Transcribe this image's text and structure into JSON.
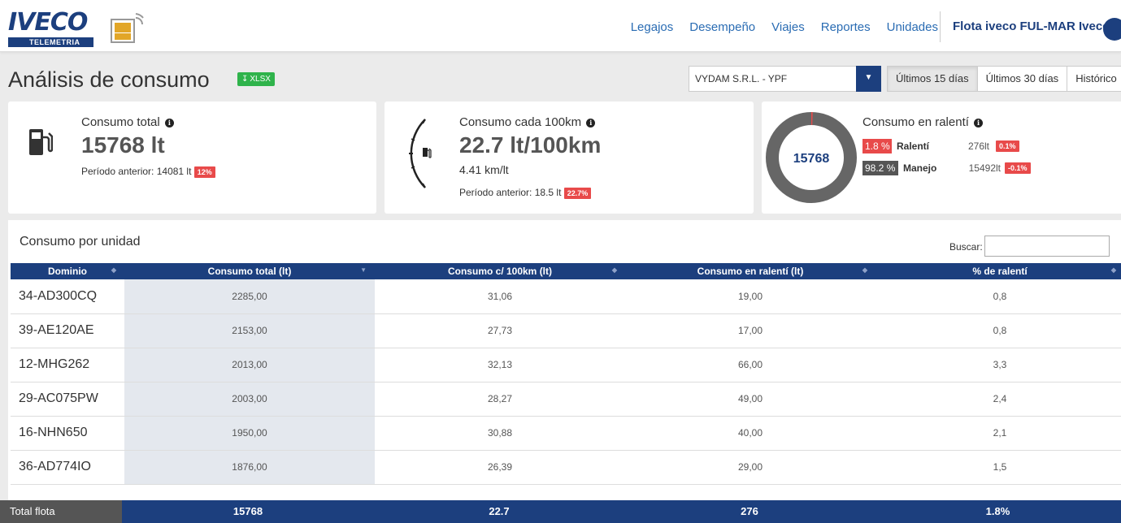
{
  "brand": {
    "name": "IVECO",
    "sub": "TELEMETRIA"
  },
  "nav": [
    "Legajos",
    "Desempeño",
    "Viajes",
    "Reportes",
    "Unidades"
  ],
  "fleet_name": "Flota iveco FUL-MAR Iveco",
  "page_title": "Análisis de consumo",
  "xlsx_label": "XLSX",
  "company_select": "VYDAM S.R.L. - YPF",
  "ranges": [
    "Últimos 15 días",
    "Últimos 30 días",
    "Histórico"
  ],
  "kpi_total": {
    "label": "Consumo total",
    "value": "15768 lt",
    "previous": "Período anterior: 14081 lt",
    "delta": "12%"
  },
  "kpi_100km": {
    "label": "Consumo cada 100km",
    "value": "22.7 lt/100km",
    "kmlt": "4.41 km/lt",
    "previous": "Período anterior: 18.5 lt",
    "delta": "22.7%"
  },
  "kpi_idle": {
    "label": "Consumo en ralentí",
    "donut_center": "15768",
    "idle_fraction": 0.018,
    "rows": [
      {
        "pct": "1.8 %",
        "name": "Ralentí",
        "liters": "276lt",
        "delta": "0.1%",
        "color": "#e84a4a"
      },
      {
        "pct": "98.2 %",
        "name": "Manejo",
        "liters": "15492lt",
        "delta": "-0.1%",
        "color": "#555555"
      }
    ]
  },
  "table": {
    "title": "Consumo por unidad",
    "search_label": "Buscar:",
    "headers": [
      "Dominio",
      "Consumo total (lt)",
      "Consumo c/ 100km (lt)",
      "Consumo en ralentí (lt)",
      "% de ralentí"
    ],
    "rows": [
      [
        "34-AD300CQ",
        "2285,00",
        "31,06",
        "19,00",
        "0,8"
      ],
      [
        "39-AE120AE",
        "2153,00",
        "27,73",
        "17,00",
        "0,8"
      ],
      [
        "12-MHG262",
        "2013,00",
        "32,13",
        "66,00",
        "3,3"
      ],
      [
        "29-AC075PW",
        "2003,00",
        "28,27",
        "49,00",
        "2,4"
      ],
      [
        "16-NHN650",
        "1950,00",
        "30,88",
        "40,00",
        "2,1"
      ],
      [
        "36-AD774IO",
        "1876,00",
        "26,39",
        "29,00",
        "1,5"
      ]
    ],
    "footer": [
      "Total flota",
      "15768",
      "22.7",
      "276",
      "1.8%"
    ]
  },
  "colors": {
    "brand": "#1c3f7e",
    "link": "#2a6cb3",
    "alert": "#e84a4a",
    "export": "#2fb34b"
  }
}
